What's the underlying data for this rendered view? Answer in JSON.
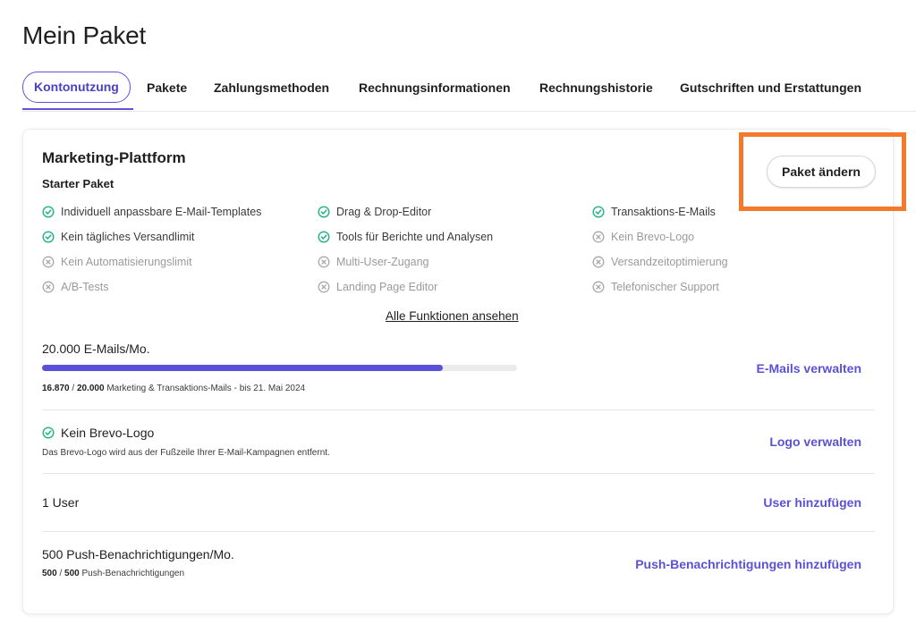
{
  "page": {
    "title": "Mein Paket"
  },
  "tabs": [
    {
      "label": "Kontonutzung",
      "active": true
    },
    {
      "label": "Pakete"
    },
    {
      "label": "Zahlungsmethoden"
    },
    {
      "label": "Rechnungsinformationen"
    },
    {
      "label": "Rechnungshistorie"
    },
    {
      "label": "Gutschriften und Erstattungen"
    }
  ],
  "plan": {
    "title": "Marketing-Plattform",
    "subtitle": "Starter Paket",
    "change_button": "Paket ändern",
    "highlight_color": "#f4792a",
    "features": [
      {
        "label": "Individuell anpassbare E-Mail-Templates",
        "included": true,
        "icon": "check-circle-icon"
      },
      {
        "label": "Drag & Drop-Editor",
        "included": true,
        "icon": "check-circle-icon"
      },
      {
        "label": "Transaktions-E-Mails",
        "included": true,
        "icon": "check-circle-icon"
      },
      {
        "label": "Kein tägliches Versandlimit",
        "included": true,
        "icon": "check-circle-icon"
      },
      {
        "label": "Tools für Berichte und Analysen",
        "included": true,
        "icon": "check-circle-icon"
      },
      {
        "label": "Kein Brevo-Logo",
        "included": false,
        "icon": "x-circle-icon"
      },
      {
        "label": "Kein Automatisierungslimit",
        "included": false,
        "icon": "x-circle-icon"
      },
      {
        "label": "Multi-User-Zugang",
        "included": false,
        "icon": "x-circle-icon"
      },
      {
        "label": "Versandzeitoptimierung",
        "included": false,
        "icon": "x-circle-icon"
      },
      {
        "label": "A/B-Tests",
        "included": false,
        "icon": "x-circle-icon"
      },
      {
        "label": "Landing Page Editor",
        "included": false,
        "icon": "x-circle-icon"
      },
      {
        "label": "Telefonischer Support",
        "included": false,
        "icon": "x-circle-icon"
      }
    ],
    "all_features_link": "Alle Funktionen ansehen"
  },
  "usage": {
    "emails": {
      "title": "20.000 E-Mails/Mo.",
      "used": "16.870",
      "total": "20.000",
      "progress_fraction": 0.8435,
      "detail": "Marketing & Transaktions-Mails - bis 21. Mai 2024",
      "action": "E-Mails verwalten"
    },
    "logo": {
      "title": "Kein Brevo-Logo",
      "detail": "Das Brevo-Logo wird aus der Fußzeile Ihrer E-Mail-Kampagnen entfernt.",
      "action": "Logo verwalten"
    },
    "users": {
      "title": "1 User",
      "action": "User hinzufügen"
    },
    "push": {
      "title": "500 Push-Benachrichtigungen/Mo.",
      "used": "500",
      "total": "500",
      "detail": "Push-Benachrichtigungen",
      "action": "Push-Benachrichtigungen hinzufügen"
    }
  },
  "colors": {
    "accent": "#5b51d8",
    "check": "#2bb48a",
    "highlight": "#f4792a"
  }
}
